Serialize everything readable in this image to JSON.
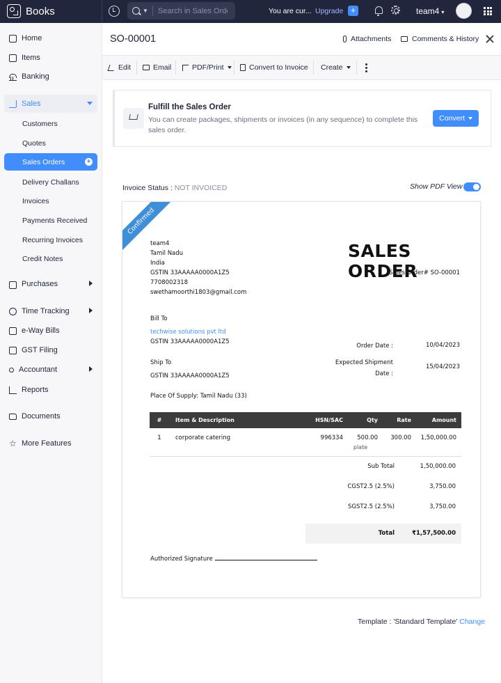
{
  "app": {
    "name": "Books"
  },
  "topbar": {
    "search_placeholder": "Search in Sales Order",
    "trial_text": "You are cur...",
    "upgrade_label": "Upgrade",
    "org_name": "team4"
  },
  "sidebar": {
    "home": "Home",
    "items": "Items",
    "banking": "Banking",
    "sales": "Sales",
    "sales_sub": [
      "Customers",
      "Quotes",
      "Sales Orders",
      "Delivery Challans",
      "Invoices",
      "Payments Received",
      "Recurring Invoices",
      "Credit Notes"
    ],
    "purchases": "Purchases",
    "time_tracking": "Time Tracking",
    "eway_bills": "e-Way Bills",
    "gst_filing": "GST Filing",
    "accountant": "Accountant",
    "reports": "Reports",
    "documents": "Documents",
    "more_features": "More Features"
  },
  "header": {
    "title": "SO-00001",
    "attachments": "Attachments",
    "comments": "Comments & History"
  },
  "toolbar": {
    "edit": "Edit",
    "email": "Email",
    "pdf_print": "PDF/Print",
    "convert_invoice": "Convert to Invoice",
    "create": "Create"
  },
  "fulfill": {
    "title": "Fulfill the Sales Order",
    "description": "You can create packages, shipments or invoices (in any sequence) to complete this sales order.",
    "button": "Convert"
  },
  "status": {
    "label": "Invoice Status :",
    "value": "NOT INVOICED",
    "pdf_view_label": "Show PDF View",
    "pdf_view_on": true
  },
  "document": {
    "ribbon": "Confirmed",
    "heading": "SALES ORDER",
    "number_line": "Sales Order# SO-00001",
    "org_lines": [
      "team4",
      "Tamil Nadu",
      "India",
      "GSTIN 33AAAAA0000A1Z5",
      "7708002318",
      "swethamoorthi1803@gmail.com"
    ],
    "bill_to_label": "Bill To",
    "bill_to_name": "techwise solutions pvt ltd",
    "bill_to_gstin": "GSTIN 33AAAAA0000A1Z5",
    "ship_to_label": "Ship To",
    "ship_to_gstin": "GSTIN 33AAAAA0000A1Z5",
    "order_date_label": "Order Date :",
    "order_date": "10/04/2023",
    "expected_label_1": "Expected Shipment",
    "expected_label_2": "Date :",
    "expected_date": "15/04/2023",
    "place_of_supply": "Place Of Supply: Tamil Nadu (33)",
    "columns": [
      "#",
      "Item & Description",
      "HSN/SAC",
      "Qty",
      "Rate",
      "Amount"
    ],
    "items": [
      {
        "no": "1",
        "desc": "corporate catering",
        "hsn": "996334",
        "qty": "500.00",
        "unit": "plate",
        "rate": "300.00",
        "amount": "1,50,000.00"
      }
    ],
    "sub_total_label": "Sub Total",
    "sub_total": "1,50,000.00",
    "cgst_label": "CGST2.5 (2.5%)",
    "cgst": "3,750.00",
    "sgst_label": "SGST2.5 (2.5%)",
    "sgst": "3,750.00",
    "total_label": "Total",
    "total": "₹1,57,500.00",
    "signature_label": "Authorized Signature"
  },
  "template": {
    "label": "Template : 'Standard Template'",
    "change": "Change"
  },
  "colors": {
    "accent": "#408dfb",
    "topbar": "#21263c",
    "ribbon": "#3f8ed8"
  }
}
